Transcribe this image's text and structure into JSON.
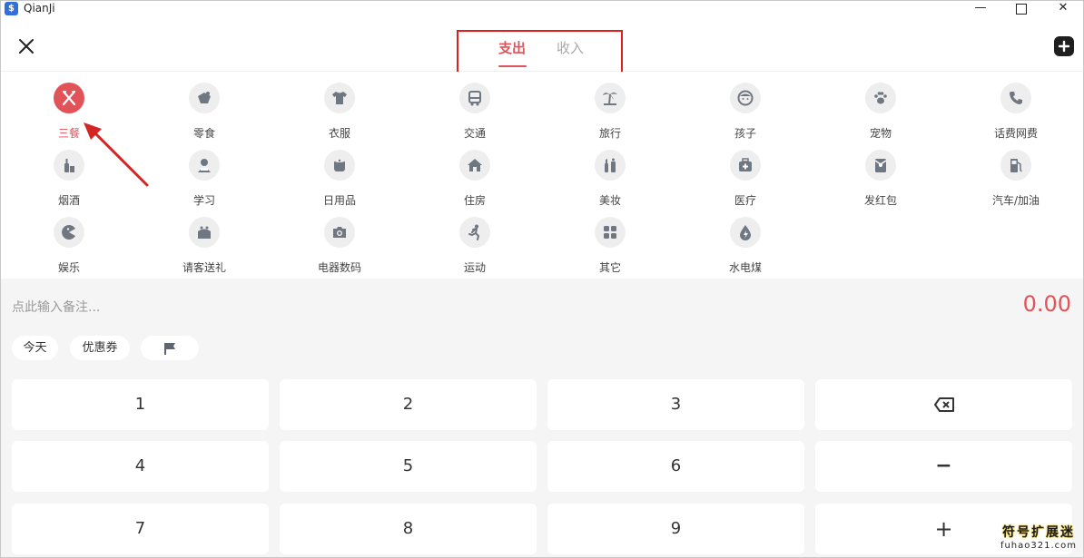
{
  "window": {
    "title": "QianJi",
    "app_icon_glyph": "$",
    "controls": {
      "minimize": "—",
      "maximize": "",
      "close": "✕"
    }
  },
  "header": {
    "close_icon": "close-icon",
    "tabs": [
      {
        "label": "支出",
        "active": true
      },
      {
        "label": "收入",
        "active": false
      }
    ],
    "add_icon": "plus-icon"
  },
  "categories": [
    {
      "label": "三餐",
      "icon": "fork-knife-icon",
      "selected": true
    },
    {
      "label": "零食",
      "icon": "snack-icon"
    },
    {
      "label": "衣服",
      "icon": "shirt-icon"
    },
    {
      "label": "交通",
      "icon": "bus-icon"
    },
    {
      "label": "旅行",
      "icon": "palm-tree-icon"
    },
    {
      "label": "孩子",
      "icon": "child-face-icon"
    },
    {
      "label": "宠物",
      "icon": "paw-icon"
    },
    {
      "label": "话费网费",
      "icon": "phone-icon"
    },
    {
      "label": "烟酒",
      "icon": "bottle-icon"
    },
    {
      "label": "学习",
      "icon": "student-icon"
    },
    {
      "label": "日用品",
      "icon": "tissue-roll-icon"
    },
    {
      "label": "住房",
      "icon": "house-icon"
    },
    {
      "label": "美妆",
      "icon": "cosmetics-icon"
    },
    {
      "label": "医疗",
      "icon": "medical-kit-icon"
    },
    {
      "label": "发红包",
      "icon": "red-packet-icon"
    },
    {
      "label": "汽车/加油",
      "icon": "gas-pump-icon"
    },
    {
      "label": "娱乐",
      "icon": "pacman-icon"
    },
    {
      "label": "请客送礼",
      "icon": "gift-icon"
    },
    {
      "label": "电器数码",
      "icon": "camera-icon"
    },
    {
      "label": "运动",
      "icon": "runner-icon"
    },
    {
      "label": "其它",
      "icon": "grid-icon"
    },
    {
      "label": "水电煤",
      "icon": "water-drop-icon"
    }
  ],
  "entry": {
    "note_placeholder": "点此输入备注...",
    "amount": "0.00",
    "chips": {
      "today": "今天",
      "coupon": "优惠券",
      "flag_icon": "flag-icon"
    }
  },
  "keypad": {
    "rows": [
      [
        "1",
        "2",
        "3",
        "backspace"
      ],
      [
        "4",
        "5",
        "6",
        "−"
      ],
      [
        "7",
        "8",
        "9",
        "+"
      ]
    ]
  },
  "watermark": {
    "line1": "符号扩展迷",
    "line2": "fuhao321.com"
  },
  "colors": {
    "accent": "#e15358",
    "inactive_tab": "#a8a8a8",
    "icon_bg": "#eeeeee",
    "icon_fg": "#6f7782",
    "annotation": "#e01e1e"
  }
}
